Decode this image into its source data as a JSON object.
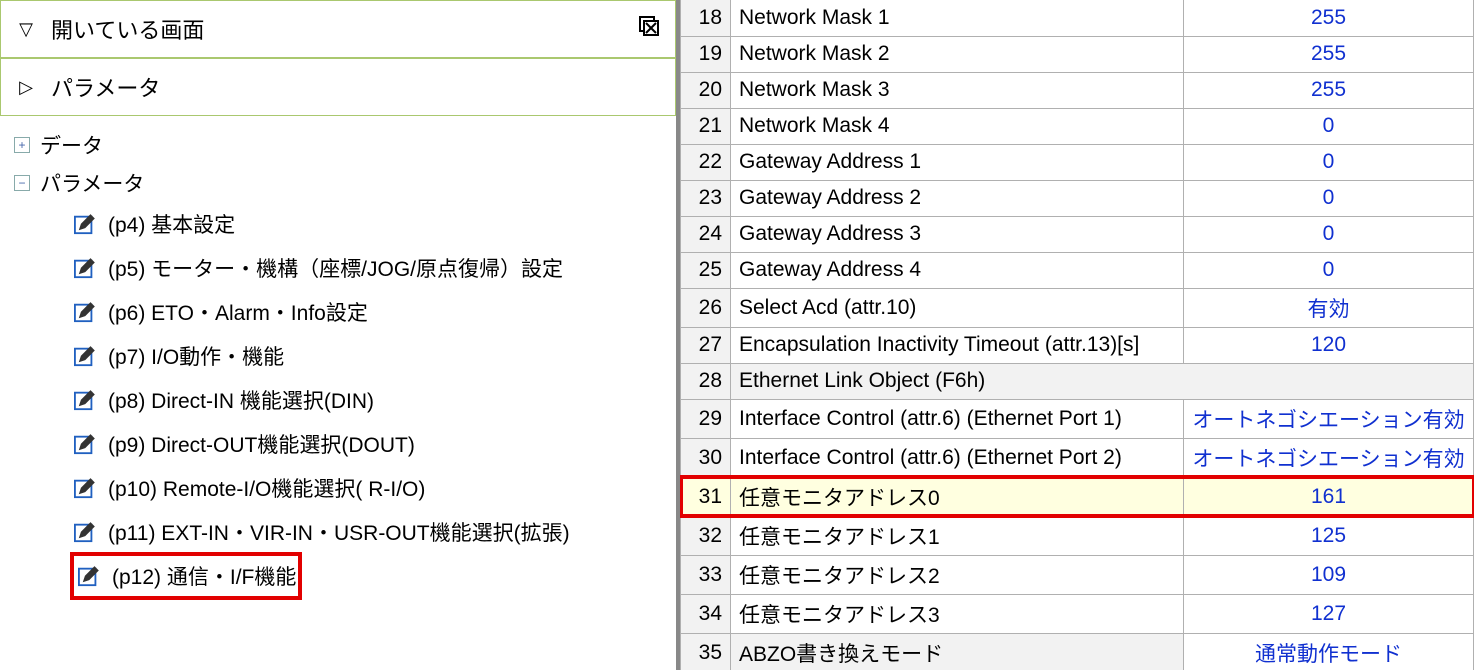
{
  "left": {
    "open_screens": {
      "label": "開いている画面",
      "icon": "stack-icon"
    },
    "parameter": {
      "label": "パラメータ"
    },
    "nodes": [
      {
        "key": "data",
        "label": "データ",
        "expanded": false
      },
      {
        "key": "param",
        "label": "パラメータ",
        "expanded": true
      }
    ],
    "param_items": [
      {
        "label": "(p4) 基本設定",
        "highlight": false
      },
      {
        "label": "(p5) モーター・機構（座標/JOG/原点復帰）設定",
        "highlight": false
      },
      {
        "label": "(p6) ETO・Alarm・Info設定",
        "highlight": false
      },
      {
        "label": "(p7) I/O動作・機能",
        "highlight": false
      },
      {
        "label": "(p8) Direct-IN 機能選択(DIN)",
        "highlight": false
      },
      {
        "label": "(p9) Direct-OUT機能選択(DOUT)",
        "highlight": false
      },
      {
        "label": "(p10) Remote-I/O機能選択( R-I/O)",
        "highlight": false
      },
      {
        "label": "(p11) EXT-IN・VIR-IN・USR-OUT機能選択(拡張)",
        "highlight": false
      },
      {
        "label": "(p12) 通信・I/F機能",
        "highlight": true
      }
    ]
  },
  "right": {
    "rows": [
      {
        "num": "18",
        "name": "Network Mask 1",
        "val": "255",
        "first": true
      },
      {
        "num": "19",
        "name": "Network Mask 2",
        "val": "255"
      },
      {
        "num": "20",
        "name": "Network Mask 3",
        "val": "255"
      },
      {
        "num": "21",
        "name": "Network Mask 4",
        "val": "0"
      },
      {
        "num": "22",
        "name": "Gateway Address 1",
        "val": "0"
      },
      {
        "num": "23",
        "name": "Gateway Address 2",
        "val": "0"
      },
      {
        "num": "24",
        "name": "Gateway Address 3",
        "val": "0"
      },
      {
        "num": "25",
        "name": "Gateway Address 4",
        "val": "0"
      },
      {
        "num": "26",
        "name": "Select Acd (attr.10)",
        "val": "有効"
      },
      {
        "num": "27",
        "name": "Encapsulation Inactivity Timeout (attr.13)[s]",
        "val": "120"
      },
      {
        "num": "28",
        "name": "Ethernet Link Object (F6h)",
        "val": "",
        "subheader": true
      },
      {
        "num": "29",
        "name": "Interface Control (attr.6) (Ethernet Port 1)",
        "val": "オートネゴシエーション有効"
      },
      {
        "num": "30",
        "name": "Interface Control (attr.6) (Ethernet Port 2)",
        "val": "オートネゴシエーション有効"
      },
      {
        "num": "31",
        "name": "任意モニタアドレス0",
        "val": "161",
        "highlight": true
      },
      {
        "num": "32",
        "name": "任意モニタアドレス1",
        "val": "125"
      },
      {
        "num": "33",
        "name": "任意モニタアドレス2",
        "val": "109"
      },
      {
        "num": "34",
        "name": "任意モニタアドレス3",
        "val": "127"
      },
      {
        "num": "35",
        "name": "ABZO書き換えモード",
        "val": "通常動作モード",
        "subheader": true
      }
    ]
  }
}
